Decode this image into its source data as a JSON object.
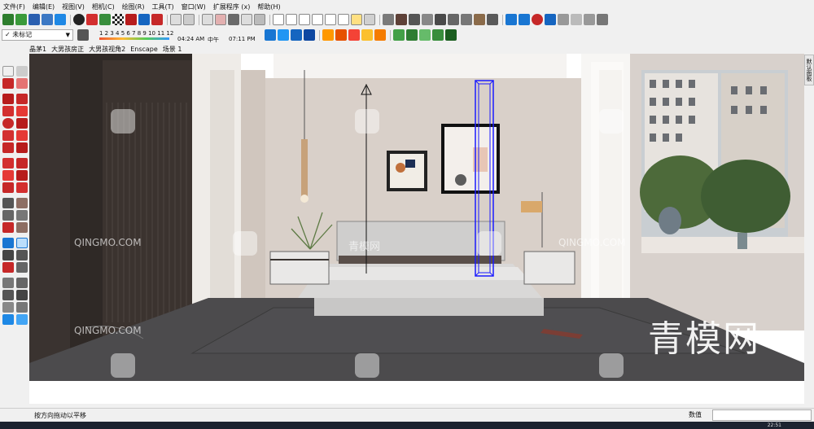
{
  "menu": [
    "文件(F)",
    "编辑(E)",
    "视图(V)",
    "相机(C)",
    "绘图(R)",
    "工具(T)",
    "窗口(W)",
    "扩展程序 (x)",
    "帮助(H)"
  ],
  "tag_selector": {
    "value": "未标记"
  },
  "shadow": {
    "months": "1 2 3 4 5 6 7 8 9 10 11 12",
    "time_start": "04:24 AM",
    "noon": "中午",
    "time_end": "07:11 PM"
  },
  "scenes": [
    "晶茅1",
    "大男孩房正",
    "大男孩视角2",
    "Enscape",
    "场景 1"
  ],
  "right_tray_tab": "默认面板",
  "status": {
    "hint": "按方向拖动以平移",
    "value_label": "数值"
  },
  "watermark": {
    "brand": "QINGMO.COM",
    "cn": "青模网",
    "big": "青模网",
    "id": "ID:1577514"
  },
  "taskbar_clock": "22:51",
  "colors": {
    "ui_bg": "#f0f0f0",
    "selection": "#1a1aff",
    "wall": "#d8cfc7",
    "floor": "#4b4a4c"
  }
}
